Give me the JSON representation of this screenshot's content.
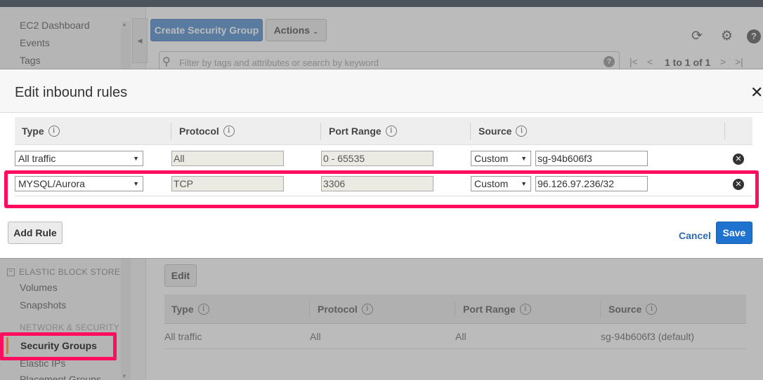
{
  "sidebar": {
    "items_top": [
      "EC2 Dashboard",
      "Events",
      "Tags"
    ],
    "ebs_heading": "ELASTIC BLOCK STORE",
    "ebs_items": [
      "Volumes",
      "Snapshots"
    ],
    "network_heading": "NETWORK & SECURITY",
    "active_item": "Security Groups",
    "items_bottom": [
      "Elastic IPs",
      "Placement Groups"
    ]
  },
  "toolbar": {
    "create_label": "Create Security Group",
    "actions_label": "Actions",
    "search_placeholder": "Filter by tags and attributes or search by keyword",
    "pagination": "1 to 1 of 1"
  },
  "detail": {
    "edit_label": "Edit",
    "columns": [
      "Type",
      "Protocol",
      "Port Range",
      "Source"
    ],
    "rows": [
      {
        "type": "All traffic",
        "protocol": "All",
        "port_range": "All",
        "source": "sg-94b606f3 (default)"
      }
    ]
  },
  "modal": {
    "title": "Edit inbound rules",
    "columns": [
      "Type",
      "Protocol",
      "Port Range",
      "Source"
    ],
    "rules": [
      {
        "type": "All traffic",
        "protocol": "All",
        "port_range": "0 - 65535",
        "source_mode": "Custom",
        "source": "sg-94b606f3"
      },
      {
        "type": "MYSQL/Aurora",
        "protocol": "TCP",
        "port_range": "3306",
        "source_mode": "Custom",
        "source": "96.126.97.236/32"
      }
    ],
    "add_rule_label": "Add Rule",
    "cancel_label": "Cancel",
    "save_label": "Save"
  },
  "colors": {
    "highlight": "#ff0d5e",
    "primary_button": "#1f73d0",
    "link": "#2a6bb3"
  }
}
